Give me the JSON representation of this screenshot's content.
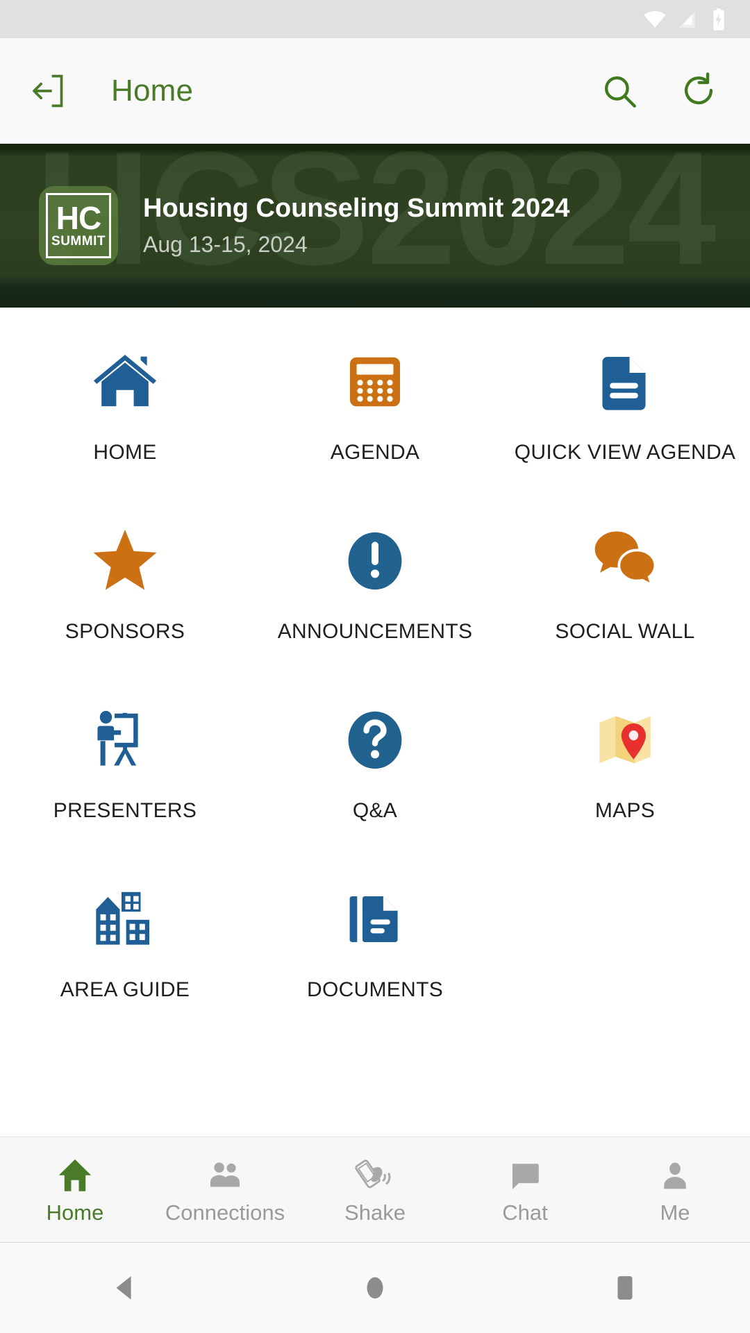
{
  "statusbar": {
    "icons": [
      "wifi-icon",
      "cellular-signal-icon",
      "battery-charging-icon"
    ]
  },
  "appbar": {
    "back_icon": "logout-icon",
    "title": "Home",
    "search_icon": "search-icon",
    "refresh_icon": "refresh-icon",
    "accent_color": "#4a7b28"
  },
  "banner": {
    "watermark": "HCS2024",
    "logo_primary": "HC",
    "logo_secondary": "SUMMIT",
    "title": "Housing Counseling Summit 2024",
    "date": "Aug 13-15, 2024",
    "background_color": "#2e4222"
  },
  "grid": {
    "tiles": [
      {
        "label": "HOME",
        "icon": "house-icon",
        "color": "#1f5f96"
      },
      {
        "label": "AGENDA",
        "icon": "calculator-icon",
        "color": "#cc7113"
      },
      {
        "label": "QUICK VIEW AGENDA",
        "icon": "document-icon",
        "color": "#1f5f96"
      },
      {
        "label": "SPONSORS",
        "icon": "star-icon",
        "color": "#cc7113"
      },
      {
        "label": "ANNOUNCEMENTS",
        "icon": "exclamation-circle-icon",
        "color": "#1f5f96"
      },
      {
        "label": "SOCIAL WALL",
        "icon": "chat-bubbles-icon",
        "color": "#cc7113"
      },
      {
        "label": "PRESENTERS",
        "icon": "presenter-easel-icon",
        "color": "#1f5f96"
      },
      {
        "label": "Q&A",
        "icon": "question-circle-icon",
        "color": "#1f5f96"
      },
      {
        "label": "MAPS",
        "icon": "folded-map-pin-icon",
        "color": "#f6d98a"
      },
      {
        "label": "AREA GUIDE",
        "icon": "buildings-icon",
        "color": "#1f5f96"
      },
      {
        "label": "DOCUMENTS",
        "icon": "documents-icon",
        "color": "#1f5f96"
      }
    ]
  },
  "bottomnav": {
    "items": [
      {
        "label": "Home",
        "icon": "home-icon",
        "active": true
      },
      {
        "label": "Connections",
        "icon": "people-icon",
        "active": false
      },
      {
        "label": "Shake",
        "icon": "shake-phone-icon",
        "active": false
      },
      {
        "label": "Chat",
        "icon": "chat-icon",
        "active": false
      },
      {
        "label": "Me",
        "icon": "person-icon",
        "active": false
      }
    ],
    "active_color": "#4a7b28",
    "inactive_color": "#9a9a9a"
  },
  "sysnav": {
    "buttons": [
      "back-triangle-icon",
      "home-circle-icon",
      "recents-square-icon"
    ]
  }
}
